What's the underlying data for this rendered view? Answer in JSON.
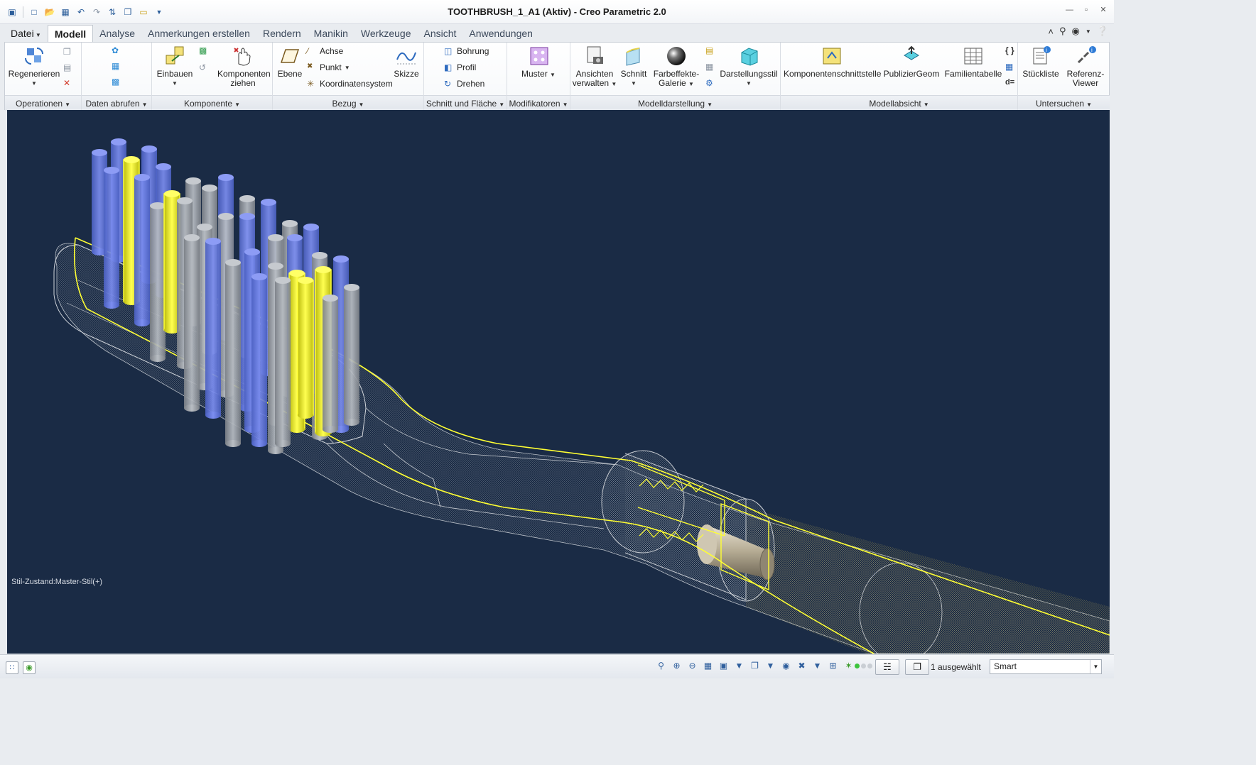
{
  "window": {
    "title": "TOOTHBRUSH_1_A1 (Aktiv) - Creo Parametric 2.0"
  },
  "quick_access": [
    "folder-icon",
    "new-file-icon",
    "open-icon",
    "save-icon",
    "undo-icon",
    "redo-icon",
    "regenerate-icon",
    "window-icon",
    "close-window-icon",
    "customize-icon"
  ],
  "tabs": [
    {
      "label": "Datei",
      "active": false
    },
    {
      "label": "Modell",
      "active": true
    },
    {
      "label": "Analyse",
      "active": false
    },
    {
      "label": "Anmerkungen erstellen",
      "active": false
    },
    {
      "label": "Rendern",
      "active": false
    },
    {
      "label": "Manikin",
      "active": false
    },
    {
      "label": "Werkzeuge",
      "active": false
    },
    {
      "label": "Ansicht",
      "active": false
    },
    {
      "label": "Anwendungen",
      "active": false
    }
  ],
  "ribbon": {
    "groups": {
      "operationen": "Operationen",
      "daten_abrufen": "Daten abrufen",
      "komponente": "Komponente",
      "bezug": "Bezug",
      "schnitt_flaeche": "Schnitt und Fläche",
      "modifikatoren": "Modifikatoren",
      "modelldarstellung": "Modelldarstellung",
      "modellabsicht": "Modellabsicht",
      "untersuchen": "Untersuchen"
    },
    "buttons": {
      "regenerieren": "Regenerieren",
      "einbauen": "Einbauen",
      "komponenten_ziehen_1": "Komponenten",
      "komponenten_ziehen_2": "ziehen",
      "ebene": "Ebene",
      "achse": "Achse",
      "punkt": "Punkt",
      "koordinatensystem": "Koordinatensystem",
      "skizze": "Skizze",
      "bohrung": "Bohrung",
      "profil": "Profil",
      "drehen": "Drehen",
      "muster": "Muster",
      "ansichten_1": "Ansichten",
      "ansichten_2": "verwalten",
      "schnitt": "Schnitt",
      "farbeffekte_1": "Farbeffekte-",
      "farbeffekte_2": "Galerie",
      "darstellungsstil": "Darstellungsstil",
      "komponentenschnittstelle": "Komponentenschnittstelle",
      "publiziergeom": "PublizierGeom",
      "familientabelle": "Familientabelle",
      "stueckliste": "Stückliste",
      "referenz_1": "Referenz-",
      "referenz_2": "Viewer",
      "relations": "d="
    }
  },
  "viewport": {
    "style_state": "Stil-Zustand:Master-Stil(+)",
    "background": "#1a2b45"
  },
  "status": {
    "selected": "1 ausgewählt",
    "filter": "Smart"
  }
}
